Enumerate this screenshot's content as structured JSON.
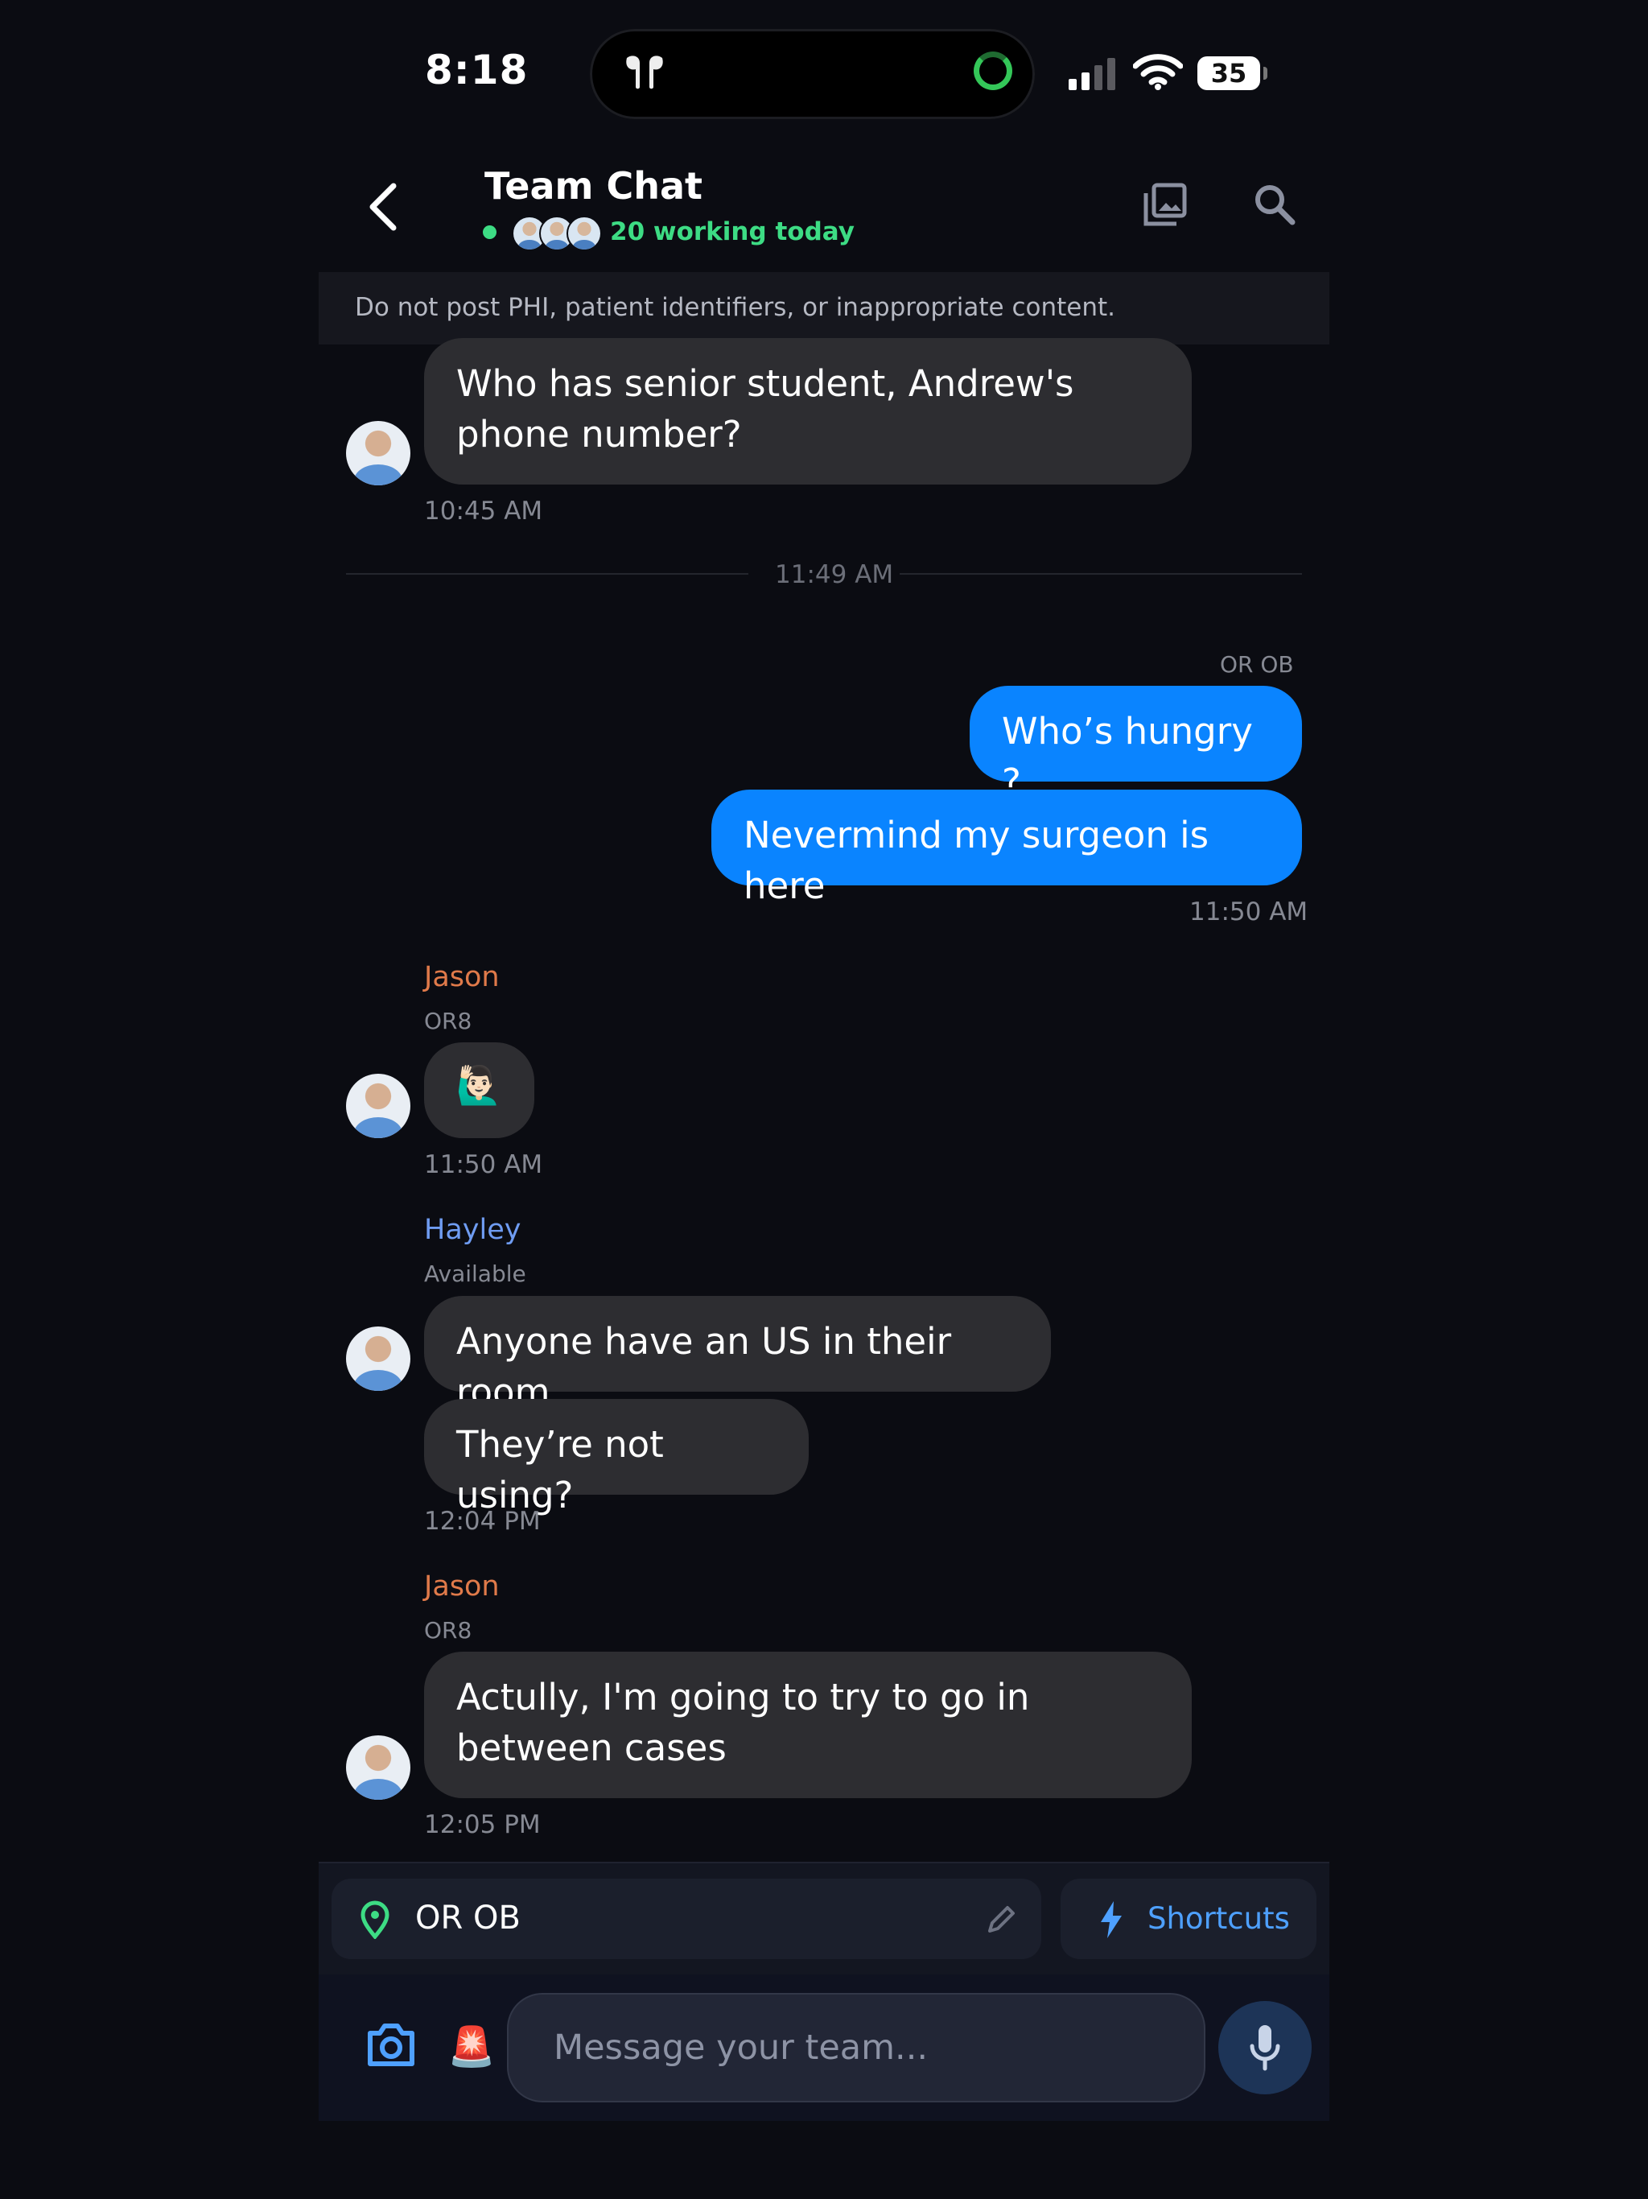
{
  "status_bar": {
    "time": "8:18",
    "battery": "35"
  },
  "header": {
    "title": "Team Chat",
    "working": "20 working today"
  },
  "notice": "Do not post PHI, patient identifiers, or inappropriate content.",
  "messages": {
    "m1": {
      "text": "Who has senior student, Andrew's phone number?",
      "time": "10:45 AM"
    },
    "divider": "11:49 AM",
    "mine": {
      "location": "OR OB",
      "b1": "Who’s hungry ?",
      "b2": "Nevermind my surgeon is here",
      "time": "11:50 AM"
    },
    "jason1": {
      "name": "Jason",
      "location": "OR8",
      "emoji": "🙋🏻‍♂️",
      "time": "11:50 AM"
    },
    "hayley": {
      "name": "Hayley",
      "status": "Available",
      "b1": "Anyone have an US in their room",
      "b2": "They’re not using?",
      "time": "12:04 PM"
    },
    "jason2": {
      "name": "Jason",
      "location": "OR8",
      "text": "Actully, I'm going to try to go in between cases",
      "time": "12:05 PM"
    }
  },
  "composer": {
    "location": "OR OB",
    "shortcuts": "Shortcuts",
    "placeholder": "Message your team...",
    "alert_emoji": "🚨"
  },
  "colors": {
    "accent": "#0a84ff",
    "online": "#3ddc84",
    "jason": "#e07a4a",
    "hayley": "#6f9cf2"
  }
}
